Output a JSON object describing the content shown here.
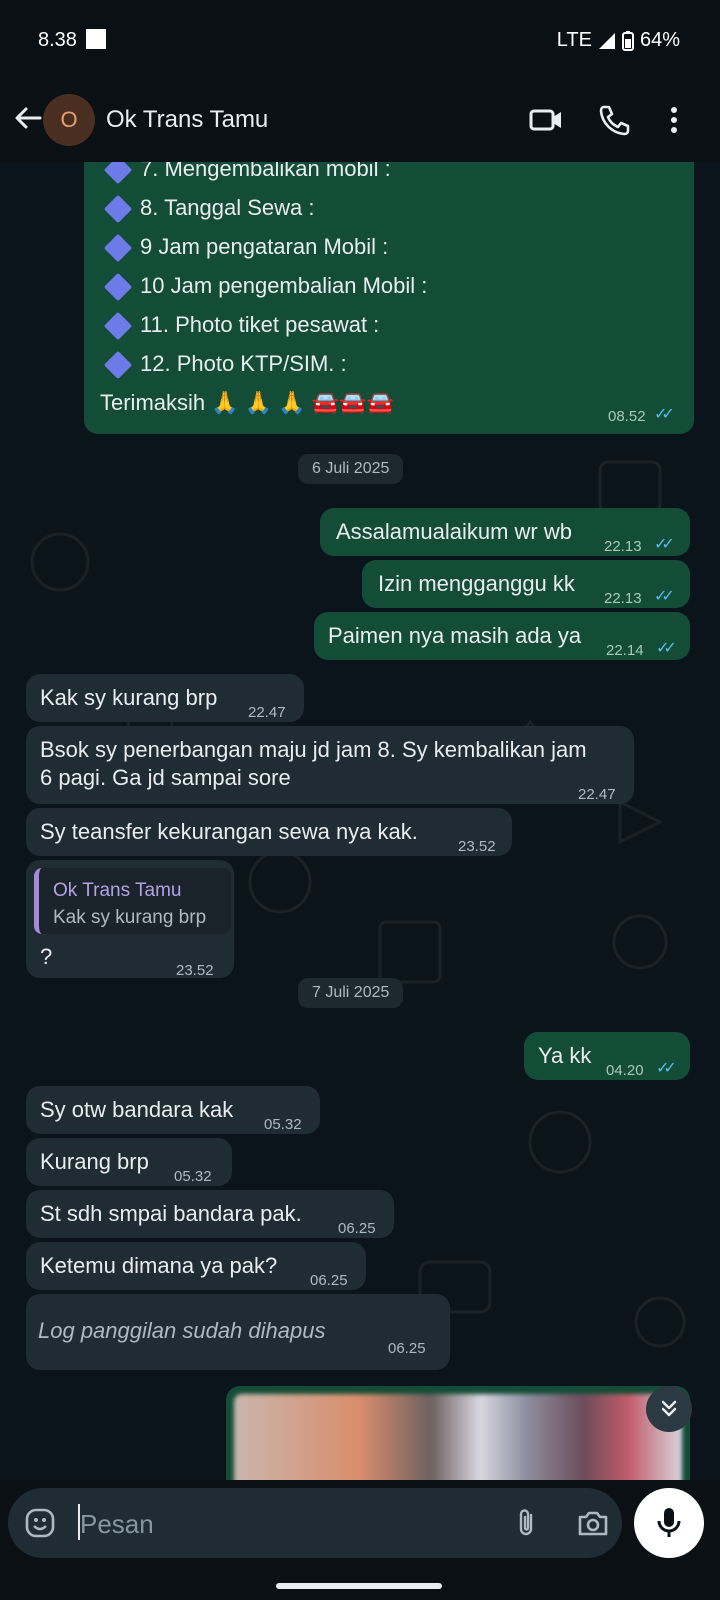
{
  "status_bar": {
    "time": "8.38",
    "network": "LTE",
    "battery": "64%"
  },
  "header": {
    "avatar_letter": "O",
    "title": "Ok Trans Tamu"
  },
  "top_message": {
    "lines": [
      "7. Mengembalikan mobil   :",
      "8. Tanggal Sewa       :",
      "9 Jam pengataran Mobil       :",
      "10 Jam  pengembalian Mobil :",
      "11. Photo tiket pesawat :",
      "12. Photo KTP/SIM. :"
    ],
    "closing": "Terimaksih 🙏 🙏 🙏 🚘🚘🚘",
    "time": "08.52"
  },
  "dates": {
    "d1": "6 Juli 2025",
    "d2": "7 Juli 2025"
  },
  "messages": {
    "m1": {
      "text": "Assalamualaikum wr wb",
      "time": "22.13"
    },
    "m2": {
      "text": "Izin mengganggu kk",
      "time": "22.13"
    },
    "m3": {
      "text": "Paimen nya masih ada ya",
      "time": "22.14"
    },
    "m4": {
      "text": "Kak sy kurang brp",
      "time": "22.47"
    },
    "m5": {
      "line1": "Bsok sy penerbangan maju jd jam 8. Sy kembalikan jam",
      "line2": "6 pagi. Ga jd sampai sore",
      "time": "22.47"
    },
    "m6": {
      "text": "Sy teansfer kekurangan sewa nya kak.",
      "time": "23.52"
    },
    "m7": {
      "quote_name": "Ok Trans Tamu",
      "quote_text": "Kak sy kurang brp",
      "text": "?",
      "time": "23.52"
    },
    "m8": {
      "text": "Ya kk",
      "time": "04.20"
    },
    "m9": {
      "text": "Sy otw bandara kak",
      "time": "05.32"
    },
    "m10": {
      "text": "Kurang brp",
      "time": "05.32"
    },
    "m11": {
      "text": "St sdh smpai bandara pak.",
      "time": "06.25"
    },
    "m12": {
      "text": "Ketemu dimana ya pak?",
      "time": "06.25"
    },
    "m13": {
      "text": "Log panggilan sudah dihapus",
      "time": "06.25"
    }
  },
  "composer": {
    "placeholder": "Pesan"
  },
  "colors": {
    "outgoing": "#144d37",
    "incoming": "#202c33",
    "read_ticks": "#53bdeb"
  }
}
